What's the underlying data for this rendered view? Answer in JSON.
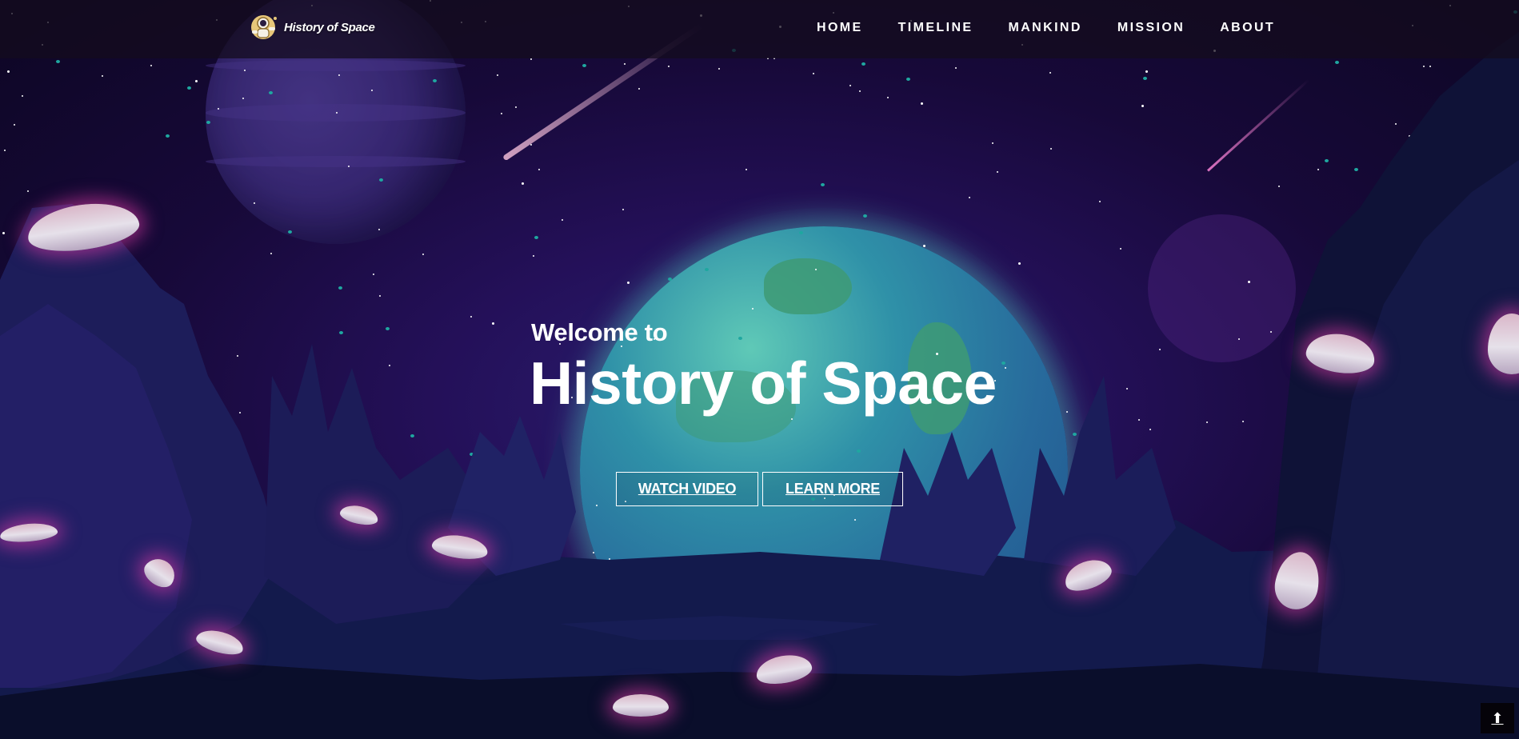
{
  "header": {
    "brand_name": "History of Space",
    "brand_icon": "astronaut-icon",
    "nav": [
      {
        "label": "HOME"
      },
      {
        "label": "TIMELINE"
      },
      {
        "label": "MANKIND"
      },
      {
        "label": "MISSION"
      },
      {
        "label": "ABOUT"
      }
    ]
  },
  "hero": {
    "welcome": "Welcome to",
    "title": "History of Space",
    "buttons": {
      "watch_video": "WATCH VIDEO",
      "learn_more": "LEARN MORE"
    }
  },
  "scroll_top": {
    "icon": "arrow-up-icon",
    "glyph": "⬆"
  },
  "colors": {
    "text": "#ffffff",
    "sky": "#241059",
    "glow": "#e63caa",
    "earth": "#2f91a8"
  }
}
